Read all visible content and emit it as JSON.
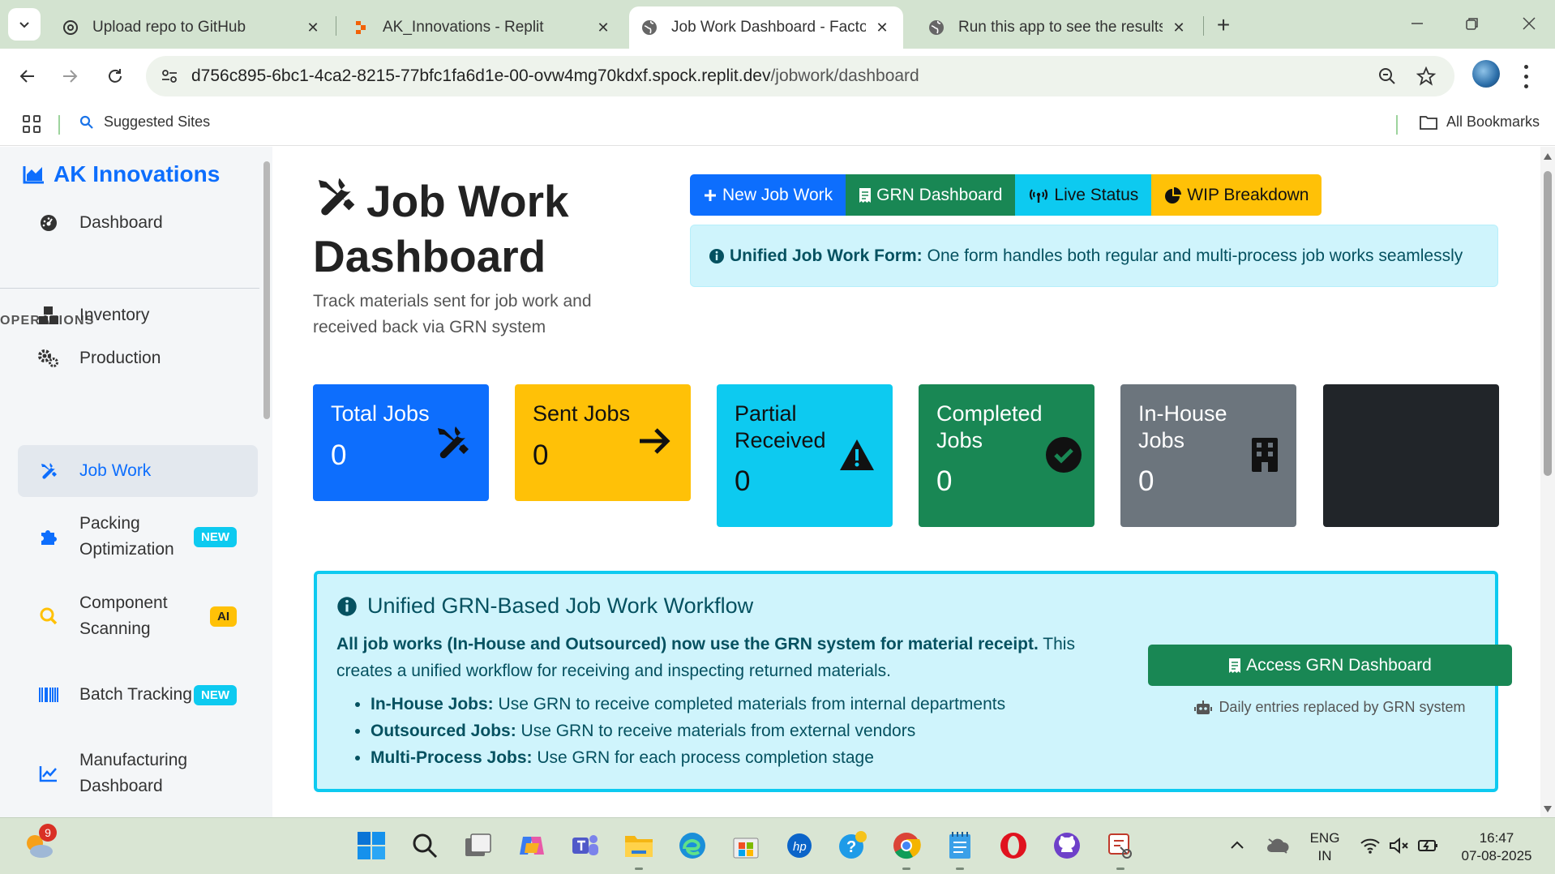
{
  "browser": {
    "tabs": [
      {
        "title": "Upload repo to GitHub",
        "icon": "openai-icon"
      },
      {
        "title": "AK_Innovations - Replit",
        "icon": "replit-icon"
      },
      {
        "title": "Job Work Dashboard - Factory I",
        "icon": "globe-icon",
        "active": true
      },
      {
        "title": "Run this app to see the results l",
        "icon": "globe-icon"
      }
    ],
    "url_host": "d756c895-6bc1-4ca2-8215-77bfc1fa6d1e-00-ovw4mg70kdxf.spock.replit.dev",
    "url_path": "/jobwork/dashboard",
    "bookmarks": {
      "suggested": "Suggested Sites",
      "all": "All Bookmarks"
    }
  },
  "sidebar": {
    "brand": "AK Innovations",
    "dashboard": "Dashboard",
    "section_heading": "OPERATIONS",
    "items": [
      {
        "label": "Inventory"
      },
      {
        "label": "Production"
      },
      {
        "label": "Job Work",
        "active": true
      },
      {
        "label": "Packing Optimization",
        "badge": "NEW"
      },
      {
        "label": "Component Scanning",
        "badge": "AI"
      },
      {
        "label": "Batch Tracking",
        "badge": "NEW"
      },
      {
        "label": "Manufacturing Dashboard"
      }
    ]
  },
  "header": {
    "title": "Job Work Dashboard",
    "subtitle": "Track materials sent for job work and received back via GRN system",
    "buttons": {
      "new_job": "New Job Work",
      "grn": "GRN Dashboard",
      "live": "Live Status",
      "wip": "WIP Breakdown"
    },
    "alert_bold": "Unified Job Work Form:",
    "alert_text": "One form handles both regular and multi-process job works seamlessly"
  },
  "stats": [
    {
      "title": "Total Jobs",
      "value": "0",
      "color": "#0d6efd"
    },
    {
      "title": "Sent Jobs",
      "value": "0",
      "color": "#ffc107"
    },
    {
      "title": "Partial Received",
      "value": "0",
      "color": "#0dcaf0"
    },
    {
      "title": "Completed Jobs",
      "value": "0",
      "color": "#198754"
    },
    {
      "title": "In-House Jobs",
      "value": "0",
      "color": "#6c757d"
    },
    {
      "title": "",
      "value": "",
      "color": "#212529"
    }
  ],
  "workflow": {
    "title": "Unified GRN-Based Job Work Workflow",
    "lead_bold": "All job works (In-House and Outsourced) now use the GRN system for material receipt.",
    "lead_rest": " This creates a unified workflow for receiving and inspecting returned materials.",
    "points": [
      {
        "bold": "In-House Jobs:",
        "text": " Use GRN to receive completed materials from internal departments"
      },
      {
        "bold": "Outsourced Jobs:",
        "text": " Use GRN to receive materials from external vendors"
      },
      {
        "bold": "Multi-Process Jobs:",
        "text": " Use GRN for each process completion stage"
      }
    ],
    "button": "Access GRN Dashboard",
    "note": "Daily entries replaced by GRN system"
  },
  "taskbar": {
    "weather_badge": "9",
    "lang_top": "ENG",
    "lang_bottom": "IN",
    "time": "16:47",
    "date": "07-08-2025"
  }
}
